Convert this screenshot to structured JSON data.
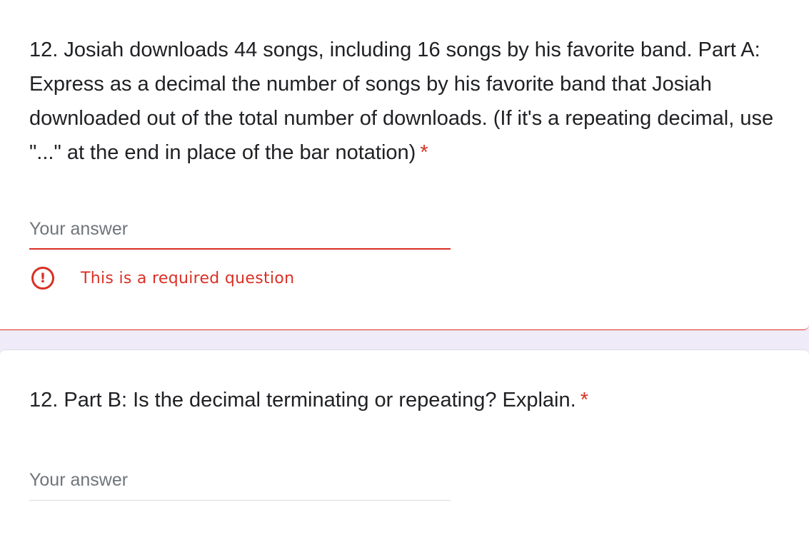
{
  "question_a": {
    "text": "12. Josiah downloads 44 songs, including 16 songs by his favorite band. Part A: Express as a decimal the number of songs by his favorite band that Josiah downloaded out of the total number of downloads. (If it's a repeating decimal, use \"...\" at the end in place of the bar notation)",
    "required_marker": "*",
    "answer_placeholder": "Your answer",
    "answer_value": "",
    "error_icon": "!",
    "error_message": "This is a required question"
  },
  "question_b": {
    "text": "12. Part B: Is the decimal terminating or repeating? Explain.",
    "required_marker": "*",
    "answer_placeholder": "Your answer",
    "answer_value": ""
  },
  "colors": {
    "error": "#d93025",
    "page_background": "#f0ebf8",
    "card_background": "#ffffff",
    "text": "#202124",
    "placeholder": "#70757a",
    "divider": "#dadce0"
  },
  "icons": {
    "error": "error-circle-exclamation-icon"
  }
}
